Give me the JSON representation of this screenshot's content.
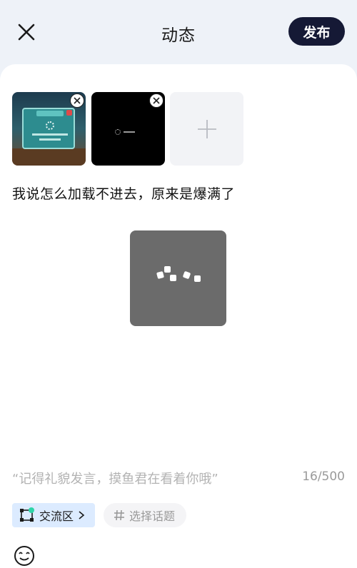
{
  "header": {
    "title": "动态",
    "publish_label": "发布"
  },
  "post": {
    "text": "我说怎么加载不进去，原来是爆满了",
    "placeholder": "“记得礼貌发言，摸鱼君在看着你哦”",
    "counter": "16/500"
  },
  "chips": {
    "community_label": "交流区",
    "topic_label": "选择话题"
  },
  "colors": {
    "header_bg": "#eef2f8",
    "publish_bg": "#151935",
    "community_chip_bg": "#dcebff",
    "loader_bg": "#6b6b6b"
  },
  "icons": {
    "close": "close-icon",
    "remove": "remove-image-icon",
    "add": "plus-icon",
    "community": "community-icon",
    "chevron": "chevron-right-icon",
    "hash": "hash-icon",
    "emoji": "emoji-icon",
    "loading": "loading-spinner-icon"
  }
}
